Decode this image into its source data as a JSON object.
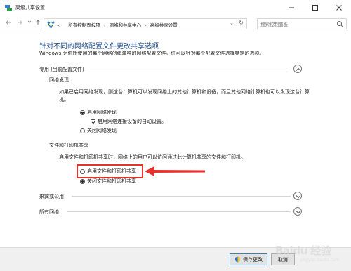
{
  "window": {
    "title": "高级共享设置",
    "app_icon": "network-sharing-icon",
    "controls": [
      "minimize-icon",
      "maximize-icon",
      "close-icon"
    ]
  },
  "navbar": {
    "back_icon": "arrow-left-icon",
    "forward_icon": "arrow-right-icon",
    "up_icon": "arrow-up-icon",
    "address": {
      "icon": "network-icon",
      "prefix": "«",
      "crumbs": [
        "所有控制面板项",
        "网络和共享中心",
        "高级共享设置"
      ]
    },
    "search_placeholder": "搜索控制面板"
  },
  "main": {
    "heading": "针对不同的网络配置文件更改共享选项",
    "description": "Windows 为你所使用的每个网络创建单独的网络配置文件。你可以针对每个配置文件选择特定的选项。",
    "profile_private": {
      "title": "专用 (当前配置文件)",
      "expanded": true,
      "network_discovery": {
        "title": "网络发现",
        "text": "如果已启用网络发现，则这台计算机可以发现网络上的其他计算机和设备，而且其他网络计算机也可以发现这台计算机。",
        "options": [
          {
            "label": "启用网络发现",
            "selected": true
          },
          {
            "label": "关闭网络发现",
            "selected": false
          }
        ],
        "auto_setup": {
          "label": "启用网络连接设备的自动设置。",
          "checked": true
        }
      },
      "file_printer_sharing": {
        "title": "文件和打印机共享",
        "text": "启用文件和打印机共享时，网络上的用户可以访问通过此计算机共享的文件和打印机。",
        "options": [
          {
            "label": "启用文件和打印机共享",
            "selected": false
          },
          {
            "label": "关闭文件和打印机共享",
            "selected": true
          }
        ]
      }
    },
    "profile_guest": {
      "title": "来宾或公用",
      "expanded": false
    },
    "profile_all": {
      "title": "所有网络",
      "expanded": false
    }
  },
  "footer": {
    "save_label": "保存更改",
    "cancel_label": "取消"
  },
  "annotation": {
    "highlight_color": "#e5322d"
  },
  "colors": {
    "heading": "#1e4e8c",
    "accent": "#3c7fb1"
  },
  "watermark": {
    "text": "Baidu 经验",
    "sub": "jingyan.baidu.com"
  }
}
